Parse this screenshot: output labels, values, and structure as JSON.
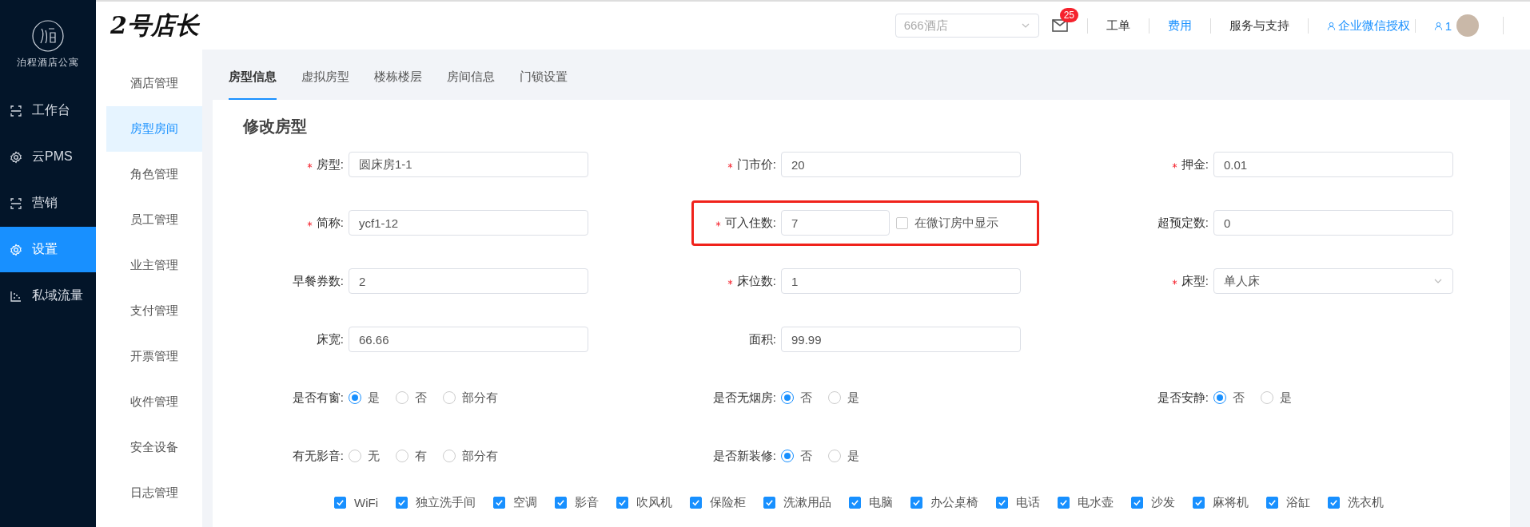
{
  "sidebar": {
    "brand": "泊程酒店公寓",
    "items": [
      {
        "label": "工作台",
        "selected": false
      },
      {
        "label": "云PMS",
        "selected": false
      },
      {
        "label": "营销",
        "selected": false
      },
      {
        "label": "设置",
        "selected": true
      },
      {
        "label": "私域流量",
        "selected": false
      }
    ]
  },
  "header": {
    "logo": "2号店长",
    "hotel_select": {
      "placeholder": "666酒店"
    },
    "mail_badge": "25",
    "links": [
      {
        "label": "工单",
        "kind": "plain"
      },
      {
        "label": "费用",
        "kind": "link"
      },
      {
        "label": "服务与支持",
        "kind": "plain"
      },
      {
        "label": "企业微信授权",
        "kind": "user-link"
      },
      {
        "label": "1",
        "kind": "user-link"
      }
    ]
  },
  "submenu": {
    "items": [
      {
        "label": "酒店管理",
        "selected": false
      },
      {
        "label": "房型房间",
        "selected": true
      },
      {
        "label": "角色管理",
        "selected": false
      },
      {
        "label": "员工管理",
        "selected": false
      },
      {
        "label": "业主管理",
        "selected": false
      },
      {
        "label": "支付管理",
        "selected": false
      },
      {
        "label": "开票管理",
        "selected": false
      },
      {
        "label": "收件管理",
        "selected": false
      },
      {
        "label": "安全设备",
        "selected": false
      },
      {
        "label": "日志管理",
        "selected": false
      }
    ]
  },
  "tabs": [
    {
      "label": "房型信息",
      "selected": true
    },
    {
      "label": "虚拟房型",
      "selected": false
    },
    {
      "label": "楼栋楼层",
      "selected": false
    },
    {
      "label": "房间信息",
      "selected": false
    },
    {
      "label": "门锁设置",
      "selected": false
    }
  ],
  "form": {
    "title": "修改房型",
    "rows": [
      [
        {
          "kind": "input",
          "label": "房型:",
          "required": true,
          "value": "圆床房1-1"
        },
        {
          "kind": "input",
          "label": "门市价:",
          "required": true,
          "value": "20"
        },
        {
          "kind": "input",
          "label": "押金:",
          "required": true,
          "value": "0.01"
        }
      ],
      [
        {
          "kind": "input",
          "label": "简称:",
          "required": true,
          "value": "ycf1-12"
        },
        {
          "kind": "input",
          "label": "可入住数:",
          "required": true,
          "value": "7",
          "highlighted": true,
          "checkbox": {
            "label": "在微订房中显示",
            "checked": false
          }
        },
        {
          "kind": "input",
          "label": "超预定数:",
          "required": false,
          "value": "0"
        }
      ],
      [
        {
          "kind": "input",
          "label": "早餐券数:",
          "required": false,
          "value": "2"
        },
        {
          "kind": "input",
          "label": "床位数:",
          "required": true,
          "value": "1"
        },
        {
          "kind": "select",
          "label": "床型:",
          "required": true,
          "value": "单人床"
        }
      ],
      [
        {
          "kind": "input",
          "label": "床宽:",
          "required": false,
          "value": "66.66"
        },
        {
          "kind": "input",
          "label": "面积:",
          "required": false,
          "value": "99.99"
        }
      ],
      [
        {
          "kind": "radio",
          "label": "是否有窗:",
          "required": false,
          "options": [
            {
              "label": "是",
              "selected": true
            },
            {
              "label": "否",
              "selected": false
            },
            {
              "label": "部分有",
              "selected": false
            }
          ]
        },
        {
          "kind": "radio",
          "label": "是否无烟房:",
          "required": false,
          "options": [
            {
              "label": "否",
              "selected": true
            },
            {
              "label": "是",
              "selected": false
            }
          ]
        },
        {
          "kind": "radio",
          "label": "是否安静:",
          "required": false,
          "options": [
            {
              "label": "否",
              "selected": true
            },
            {
              "label": "是",
              "selected": false
            }
          ]
        }
      ],
      [
        {
          "kind": "radio",
          "label": "有无影音:",
          "required": false,
          "options": [
            {
              "label": "无",
              "selected": false
            },
            {
              "label": "有",
              "selected": false
            },
            {
              "label": "部分有",
              "selected": false
            }
          ]
        },
        {
          "kind": "radio",
          "label": "是否新装修:",
          "required": false,
          "options": [
            {
              "label": "否",
              "selected": true
            },
            {
              "label": "是",
              "selected": false
            }
          ]
        }
      ]
    ],
    "amenities": [
      {
        "label": "WiFi",
        "checked": true
      },
      {
        "label": "独立洗手间",
        "checked": true
      },
      {
        "label": "空调",
        "checked": true
      },
      {
        "label": "影音",
        "checked": true
      },
      {
        "label": "吹风机",
        "checked": true
      },
      {
        "label": "保险柜",
        "checked": true
      },
      {
        "label": "洗漱用品",
        "checked": true
      },
      {
        "label": "电脑",
        "checked": true
      },
      {
        "label": "办公桌椅",
        "checked": true
      },
      {
        "label": "电话",
        "checked": true
      },
      {
        "label": "电水壶",
        "checked": true
      },
      {
        "label": "沙发",
        "checked": true
      },
      {
        "label": "麻将机",
        "checked": true
      },
      {
        "label": "浴缸",
        "checked": true
      },
      {
        "label": "洗衣机",
        "checked": true
      }
    ]
  }
}
